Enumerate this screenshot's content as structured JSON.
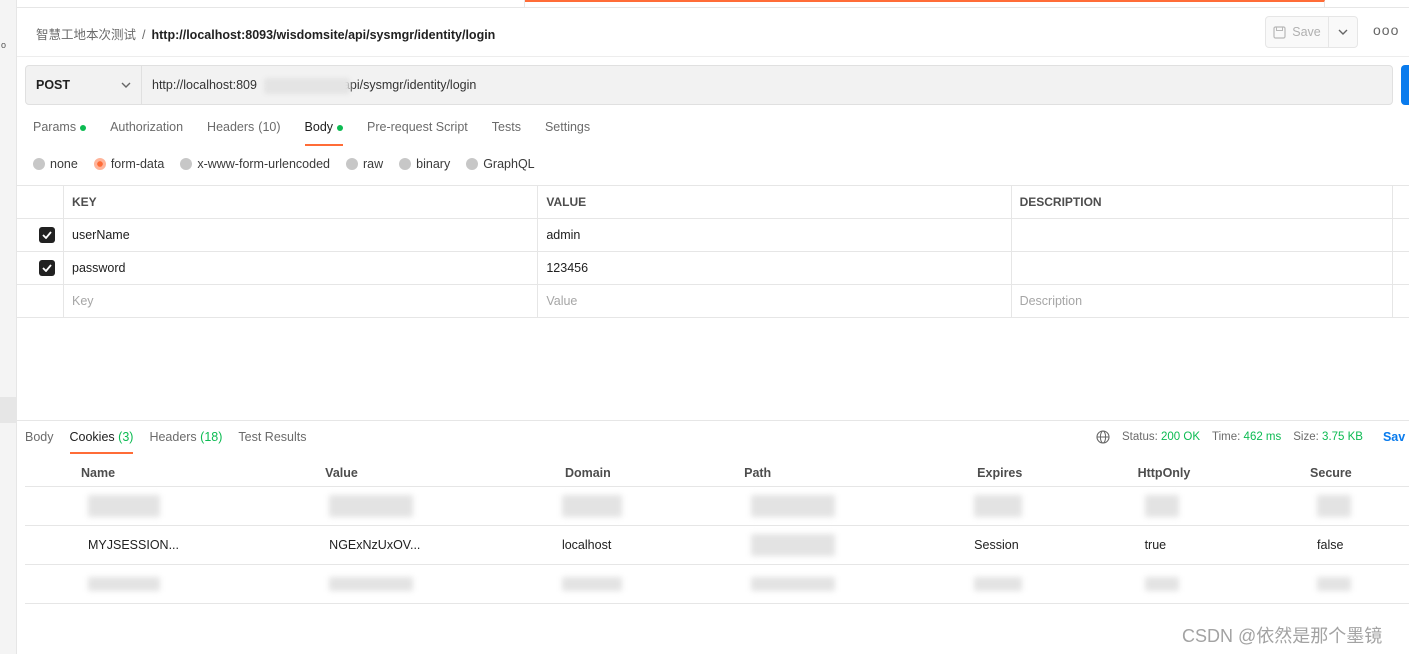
{
  "header": {
    "collection": "智慧工地本次测试",
    "separator": "/",
    "request_name": "http://localhost:8093/wisdomsite/api/sysmgr/identity/login",
    "save_label": "Save",
    "more_label": "ooo"
  },
  "request": {
    "method": "POST",
    "url_prefix": "http://localhost:809",
    "url_suffix": "api/sysmgr/identity/login"
  },
  "request_tabs": [
    {
      "label": "Params",
      "dot": true
    },
    {
      "label": "Authorization",
      "count": ""
    },
    {
      "label": "Headers",
      "count": "(10)"
    },
    {
      "label": "Body",
      "dot": true
    },
    {
      "label": "Pre-request Script"
    },
    {
      "label": "Tests"
    },
    {
      "label": "Settings"
    }
  ],
  "body_types": [
    "none",
    "form-data",
    "x-www-form-urlencoded",
    "raw",
    "binary",
    "GraphQL"
  ],
  "form_table": {
    "headers": [
      "KEY",
      "VALUE",
      "DESCRIPTION"
    ],
    "rows": [
      {
        "key": "userName",
        "value": "admin",
        "description": ""
      },
      {
        "key": "password",
        "value": "123456",
        "description": ""
      }
    ],
    "placeholders": {
      "key": "Key",
      "value": "Value",
      "description": "Description"
    }
  },
  "response": {
    "tabs": [
      {
        "label": "Body"
      },
      {
        "label": "Cookies",
        "count": "(3)"
      },
      {
        "label": "Headers",
        "count": "(18)"
      },
      {
        "label": "Test Results"
      }
    ],
    "status_label": "Status:",
    "status_value": "200 OK",
    "time_label": "Time:",
    "time_value": "462 ms",
    "size_label": "Size:",
    "size_value": "3.75 KB",
    "save_label": "Sav"
  },
  "cookies_table": {
    "headers": [
      "Name",
      "Value",
      "Domain",
      "Path",
      "Expires",
      "HttpOnly",
      "Secure"
    ],
    "row": {
      "name": "MYJSESSION...",
      "value": "NGExNzUxOV...",
      "domain": "localhost",
      "expires": "Session",
      "httponly": "true",
      "secure": "false"
    }
  },
  "watermark": "CSDN @依然是那个墨镜",
  "colors": {
    "accent": "#ff6c37",
    "success": "#0cbb52",
    "link": "#097bed"
  }
}
